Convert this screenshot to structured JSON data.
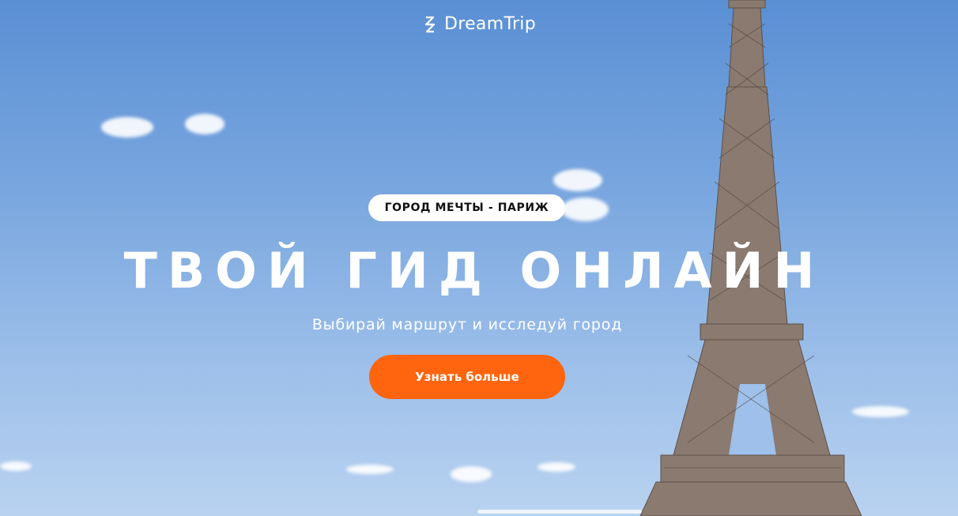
{
  "header": {
    "brand": "DreamTrip",
    "logo_icon": "dreamtrip-logo-icon"
  },
  "hero": {
    "tagline": "ГОРОД МЕЧТЫ - ПАРИЖ",
    "title": "ТВОЙ ГИД ОНЛАЙН",
    "subtitle": "Выбирай маршрут и исследуй город",
    "cta_label": "Узнать больше"
  },
  "colors": {
    "accent": "#ff640f",
    "sky": "#7aa7df",
    "text": "#ffffff"
  },
  "background": {
    "scene": "eiffel-tower-image"
  }
}
